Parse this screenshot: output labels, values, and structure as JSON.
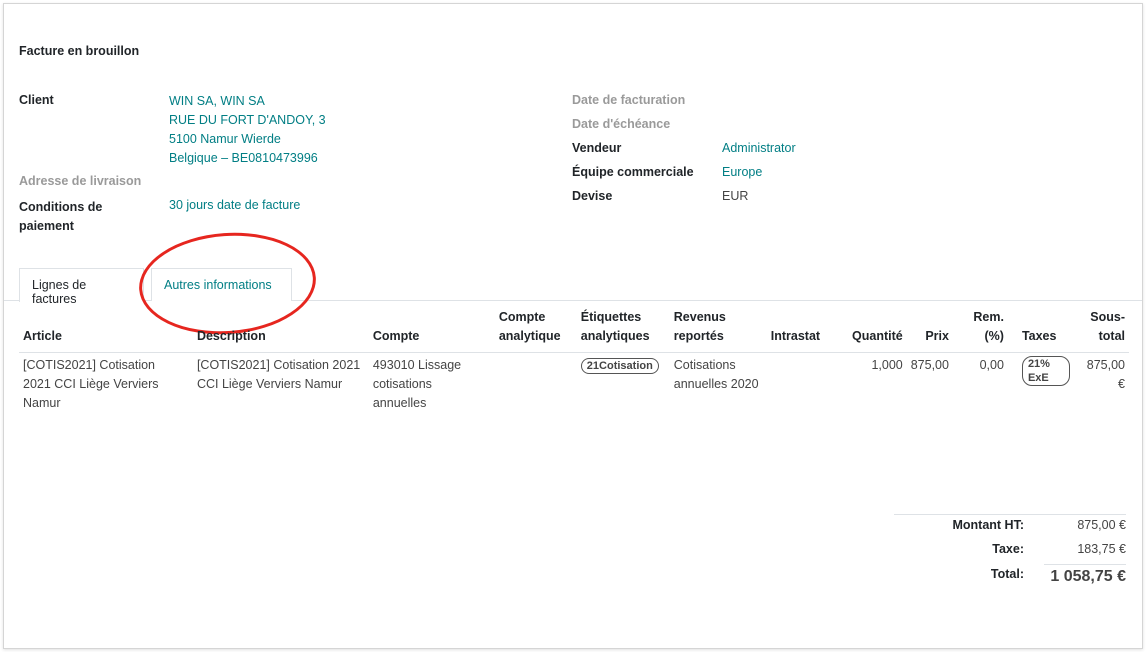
{
  "title": "Facture en brouillon",
  "left_fields": {
    "client_label": "Client",
    "client_lines": [
      "WIN SA, WIN SA",
      "RUE DU FORT D'ANDOY, 3",
      "5100 Namur Wierde",
      "Belgique – BE0810473996"
    ],
    "delivery_label": "Adresse de livraison",
    "payment_label_1": "Conditions de",
    "payment_label_2": "paiement",
    "payment_value": "30 jours date de facture"
  },
  "right_fields": {
    "invoice_date_label": "Date de facturation",
    "due_date_label": "Date d'échéance",
    "salesperson_label": "Vendeur",
    "salesperson_value": "Administrator",
    "team_label": "Équipe commerciale",
    "team_value": "Europe",
    "currency_label": "Devise",
    "currency_value": "EUR"
  },
  "tabs": [
    {
      "label": "Lignes de factures"
    },
    {
      "label": "Autres informations"
    }
  ],
  "columns": {
    "article": "Article",
    "description": "Description",
    "account": "Compte",
    "analytic_account_1": "Compte",
    "analytic_account_2": "analytique",
    "analytic_tags_1": "Étiquettes",
    "analytic_tags_2": "analytiques",
    "deferred_1": "Revenus",
    "deferred_2": "reportés",
    "intrastat": "Intrastat",
    "quantity": "Quantité",
    "price": "Prix",
    "discount_1": "Rem.",
    "discount_2": "(%)",
    "taxes": "Taxes",
    "subtotal_1": "Sous-",
    "subtotal_2": "total"
  },
  "rows": [
    {
      "article_lines": [
        "[COTIS2021] Cotisation",
        "2021 CCI Liège Verviers",
        "Namur"
      ],
      "description_lines": [
        "[COTIS2021] Cotisation 2021",
        "CCI Liège Verviers Namur"
      ],
      "account_lines": [
        "493010 Lissage",
        "cotisations",
        "annuelles"
      ],
      "analytic_tag": "21Cotisation",
      "deferred_lines": [
        "Cotisations",
        "annuelles 2020"
      ],
      "quantity": "1,000",
      "price": "875,00",
      "discount": "0,00",
      "tax": "21% ExE",
      "subtotal": "875,00 €"
    }
  ],
  "totals": {
    "untaxed_label": "Montant HT:",
    "untaxed_value": "875,00 €",
    "tax_label": "Taxe:",
    "tax_value": "183,75 €",
    "total_label": "Total:",
    "total_value": "1 058,75 €"
  },
  "colors": {
    "link": "#017e84",
    "highlight_circle": "#e6261f"
  }
}
